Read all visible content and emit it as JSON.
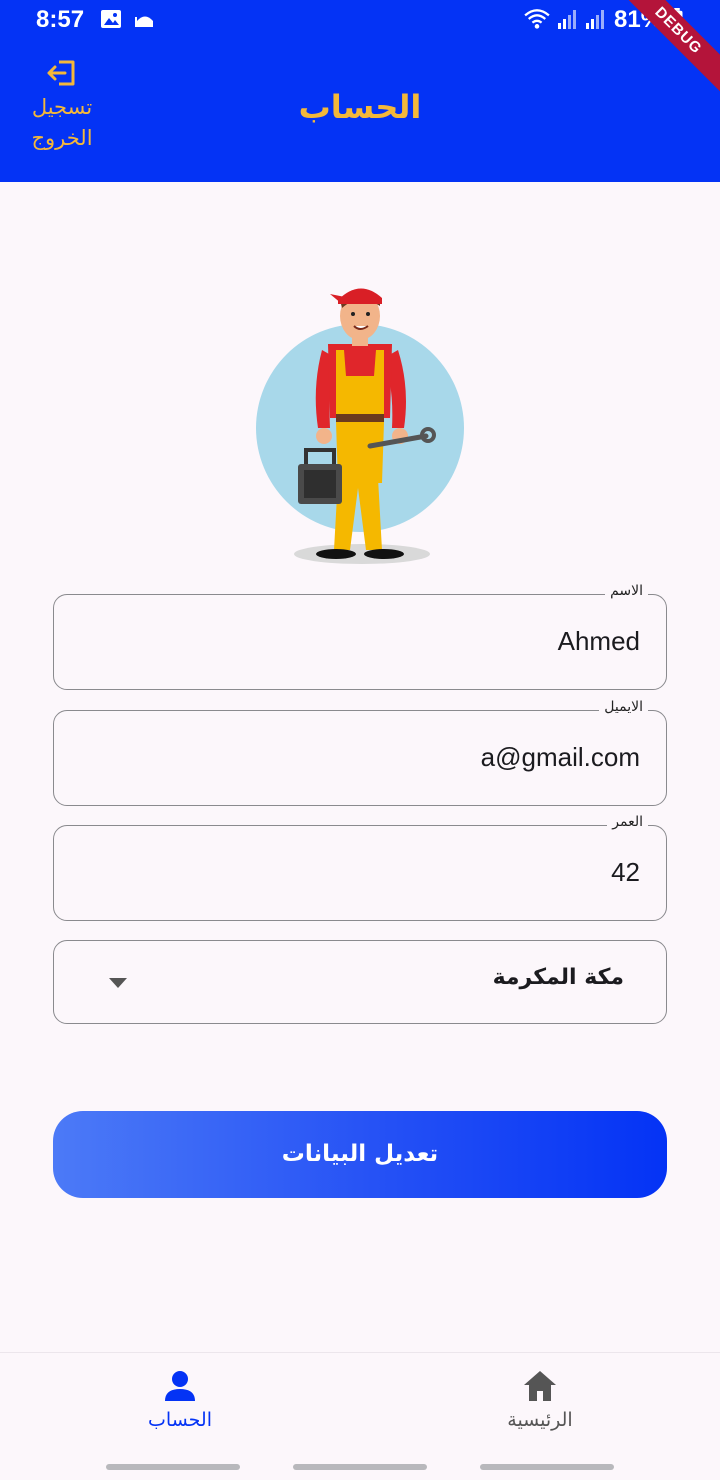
{
  "status_bar": {
    "time": "8:57",
    "battery_percent": "81%",
    "debug_label": "DEBUG"
  },
  "app_bar": {
    "title": "الحساب",
    "logout_line1": "تسجيل",
    "logout_line2": "الخروج"
  },
  "form": {
    "name_label": "الاسم",
    "name_value": "Ahmed",
    "email_label": "الايميل",
    "email_value": "a@gmail.com",
    "age_label": "العمر",
    "age_value": "42",
    "city_value": "مكة المكرمة"
  },
  "submit_button": {
    "label": "تعديل البيانات"
  },
  "bottom_nav": {
    "account_label": "الحساب",
    "home_label": "الرئيسية",
    "active": "account"
  },
  "colors": {
    "primary": "#0433f5",
    "accent": "#f4b83a",
    "background": "#fcf7fb"
  },
  "icons": {
    "logout": "logout-icon",
    "account": "person-icon",
    "home": "home-icon",
    "dropdown": "caret-down-icon"
  }
}
